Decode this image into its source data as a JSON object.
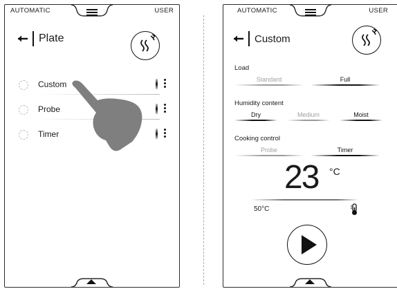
{
  "left_screen": {
    "mode_label": "AUTOMATIC",
    "user_label": "USER",
    "title": "Plate",
    "items": [
      {
        "label": "Custom"
      },
      {
        "label": "Probe"
      },
      {
        "label": "Timer"
      }
    ]
  },
  "right_screen": {
    "mode_label": "AUTOMATIC",
    "user_label": "USER",
    "title": "Custom",
    "load": {
      "label": "Load",
      "options": [
        "Standard",
        "Full"
      ],
      "selected": "Full"
    },
    "humidity": {
      "label": "Humidity content",
      "options": [
        "Dry",
        "Medium",
        "Moist"
      ],
      "selected": [
        "Dry",
        "Moist"
      ]
    },
    "cooking_control": {
      "label": "Cooking control",
      "options": [
        "Probe",
        "Timer"
      ],
      "selected": "Timer"
    },
    "temperature": {
      "value": "23",
      "unit": "°C"
    },
    "probe_temperature": "50°C"
  },
  "icons": {
    "menu": "menu-icon",
    "back": "back-arrow-icon",
    "steam": "steam-refresh-icon",
    "more": "more-vertical-icon",
    "thermometer": "thermometer-icon",
    "play": "play-icon",
    "expand": "chevron-up-icon",
    "gesture": "pointing-hand-icon"
  },
  "colors": {
    "ink": "#111111",
    "inactive": "#a0a0a0",
    "hand": "#7f7f7f"
  }
}
